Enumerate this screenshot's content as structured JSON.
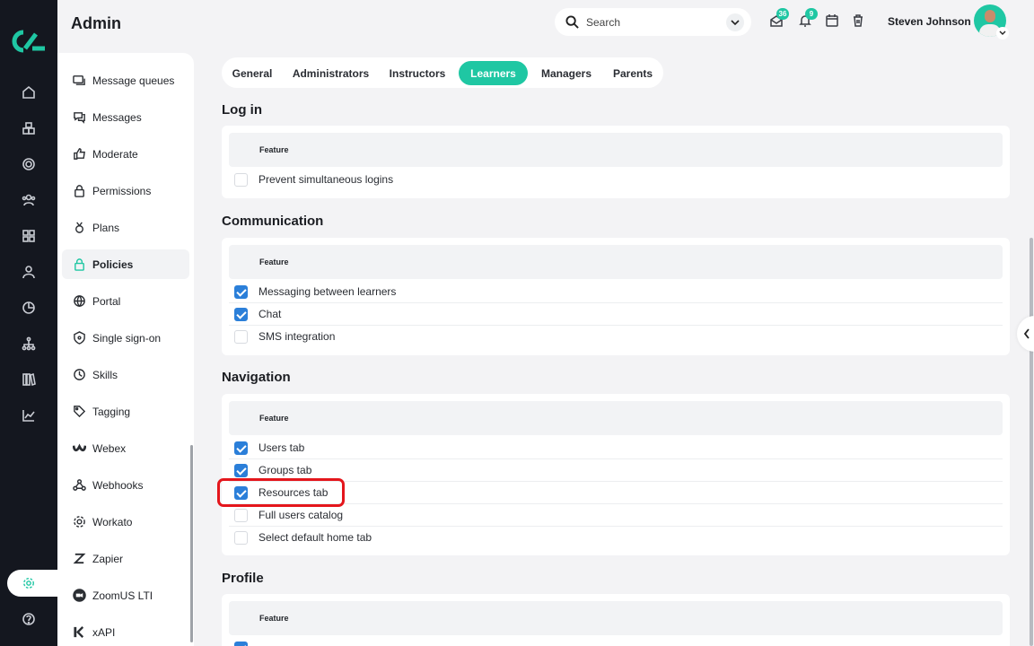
{
  "app": {
    "title": "Admin"
  },
  "header": {
    "search_label": "Search",
    "messages_count": "36",
    "notifications_count": "9",
    "user_name": "Steven Johnson"
  },
  "subnav": {
    "items": [
      {
        "label": "Message queues",
        "icon": "message-queues-icon"
      },
      {
        "label": "Messages",
        "icon": "messages-icon"
      },
      {
        "label": "Moderate",
        "icon": "thumbs-up-icon"
      },
      {
        "label": "Permissions",
        "icon": "lock-icon"
      },
      {
        "label": "Plans",
        "icon": "plans-icon"
      },
      {
        "label": "Policies",
        "icon": "lock-icon",
        "active": true
      },
      {
        "label": "Portal",
        "icon": "globe-icon"
      },
      {
        "label": "Single sign-on",
        "icon": "shield-icon"
      },
      {
        "label": "Skills",
        "icon": "clock-icon"
      },
      {
        "label": "Tagging",
        "icon": "tag-icon"
      },
      {
        "label": "Webex",
        "icon": "webex-icon"
      },
      {
        "label": "Webhooks",
        "icon": "webhooks-icon"
      },
      {
        "label": "Workato",
        "icon": "gear-icon"
      },
      {
        "label": "Zapier",
        "icon": "zapier-icon"
      },
      {
        "label": "ZoomUS LTI",
        "icon": "zoom-icon"
      },
      {
        "label": "xAPI",
        "icon": "xapi-icon"
      }
    ]
  },
  "tabs": [
    {
      "label": "General"
    },
    {
      "label": "Administrators"
    },
    {
      "label": "Instructors"
    },
    {
      "label": "Learners",
      "active": true
    },
    {
      "label": "Managers"
    },
    {
      "label": "Parents"
    }
  ],
  "sections": [
    {
      "title": "Log in",
      "header": "Feature",
      "rows": [
        {
          "label": "Prevent simultaneous logins",
          "checked": false
        }
      ]
    },
    {
      "title": "Communication",
      "header": "Feature",
      "rows": [
        {
          "label": "Messaging between learners",
          "checked": true
        },
        {
          "label": "Chat",
          "checked": true
        },
        {
          "label": "SMS integration",
          "checked": false
        }
      ]
    },
    {
      "title": "Navigation",
      "header": "Feature",
      "rows": [
        {
          "label": "Users tab",
          "checked": true
        },
        {
          "label": "Groups tab",
          "checked": true
        },
        {
          "label": "Resources tab",
          "checked": true
        },
        {
          "label": "Full users catalog",
          "checked": false
        },
        {
          "label": "Select default home tab",
          "checked": false
        }
      ]
    },
    {
      "title": "Profile",
      "header": "Feature",
      "rows": []
    }
  ],
  "colors": {
    "accent": "#1fc7a3",
    "checkbox": "#2b7fd9",
    "highlight": "#e4161c",
    "rail": "#14171f"
  }
}
